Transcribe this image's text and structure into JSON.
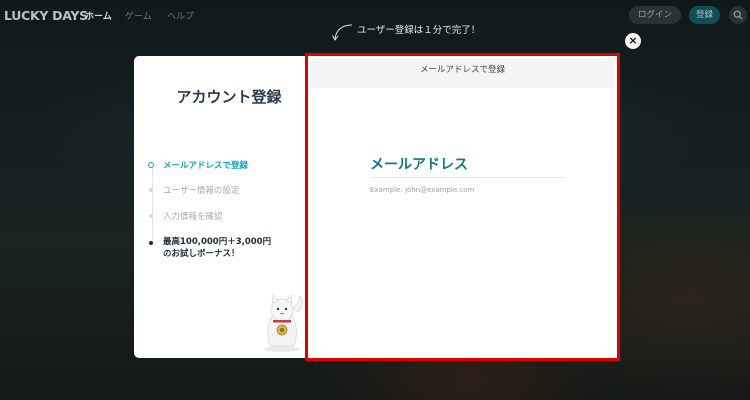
{
  "header": {
    "logo": "LUCKY DAYS",
    "nav": [
      "ホーム",
      "ゲーム",
      "ヘルプ"
    ],
    "login_label": "ログイン",
    "register_label": "登録",
    "search_icon": "search-icon"
  },
  "hint": {
    "text": "ユーザー登録は１分で完了！"
  },
  "modal": {
    "close_label": "×",
    "title": "アカウント登録",
    "steps": [
      {
        "label": "メールアドレスで登録",
        "state": "active"
      },
      {
        "label": "ユーザー情報の設定",
        "state": "pending"
      },
      {
        "label": "入力情報を確認",
        "state": "pending"
      },
      {
        "label": "最高100,000円＋3,000円のお試しボーナス！",
        "state": "bonus"
      }
    ],
    "form": {
      "header": "メールアドレスで登録",
      "email_label": "メールアドレス",
      "email_placeholder": "Example: john@example.com",
      "email_value": ""
    }
  },
  "colors": {
    "accent": "#1aa3b4",
    "label_teal": "#0f7686",
    "highlight_border": "#e30000"
  }
}
